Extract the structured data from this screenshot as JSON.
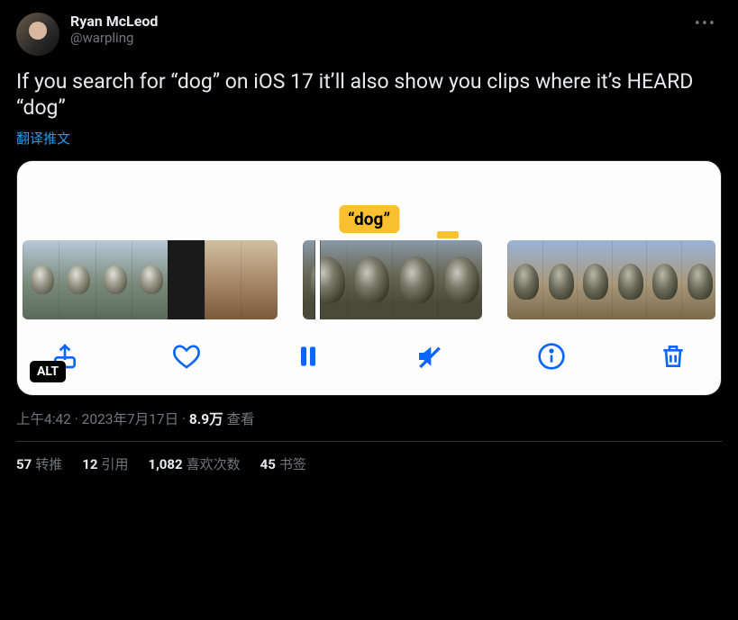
{
  "author": {
    "display_name": "Ryan McLeod",
    "handle": "@warpling"
  },
  "body": "If you search for “dog” on iOS 17 it’ll also show you clips where it’s HEARD “dog”",
  "translate_label": "翻译推文",
  "media": {
    "caption": "“dog”",
    "alt_badge": "ALT",
    "icons": {
      "share": "share-icon",
      "like": "heart-icon",
      "pause": "pause-icon",
      "mute": "mute-icon",
      "info": "info-icon",
      "delete": "trash-icon"
    }
  },
  "meta": {
    "time": "上午4:42",
    "date": "2023年7月17日",
    "views_count": "8.9万",
    "views_label": "查看",
    "dot": " · "
  },
  "stats": {
    "retweets": {
      "count": "57",
      "label": "转推"
    },
    "quotes": {
      "count": "12",
      "label": "引用"
    },
    "likes": {
      "count": "1,082",
      "label": "喜欢次数"
    },
    "bookmarks": {
      "count": "45",
      "label": "书签"
    }
  }
}
